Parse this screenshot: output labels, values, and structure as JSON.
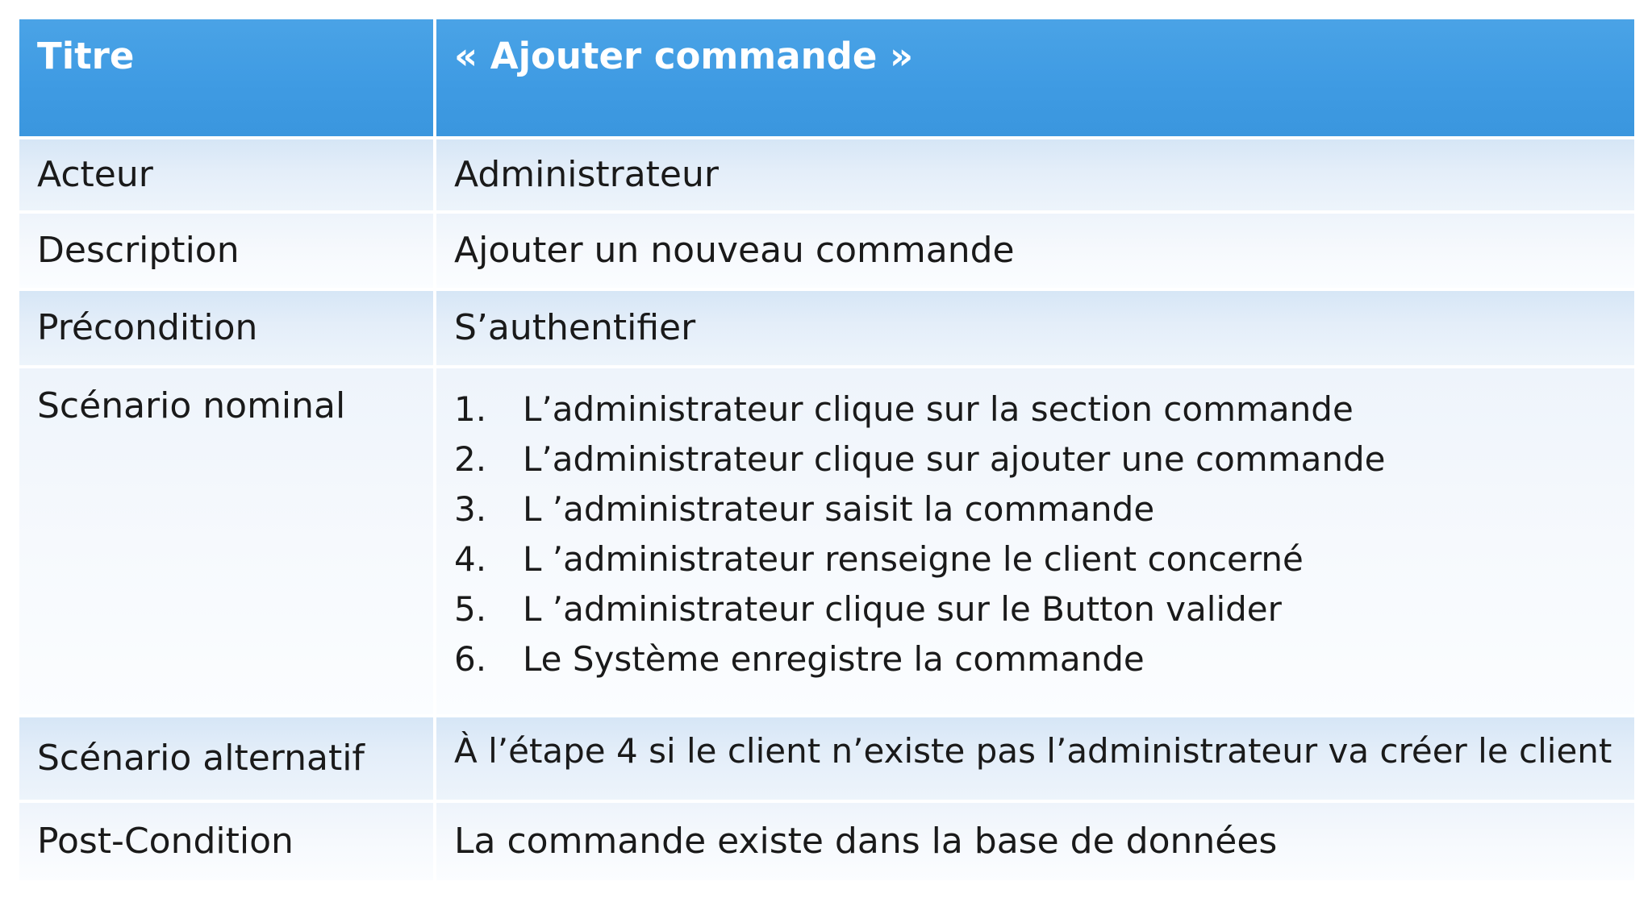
{
  "header": {
    "label": "Titre",
    "value": "« Ajouter commande  »"
  },
  "rows": [
    {
      "label": "Acteur",
      "value": "Administrateur"
    },
    {
      "label": "Description",
      "value": "Ajouter un nouveau commande"
    },
    {
      "label": "Précondition",
      "value": "S’authentifier"
    }
  ],
  "scenario": {
    "label": "Scénario nominal",
    "steps": [
      {
        "num": "1.",
        "text": "L’administrateur clique sur la section commande"
      },
      {
        "num": "2.",
        "text": "L’administrateur clique sur ajouter une commande"
      },
      {
        "num": "3.",
        "text": "L ’administrateur saisit la commande"
      },
      {
        "num": "4.",
        "text": "L ’administrateur renseigne le client concerné"
      },
      {
        "num": "5.",
        "text": "L ’administrateur clique sur le Button valider"
      },
      {
        "num": "6.",
        "text": "Le Système enregistre la commande"
      }
    ]
  },
  "alternative": {
    "label": "Scénario alternatif",
    "value": "À l’étape 4 si le client n’existe pas l’administrateur va créer le client"
  },
  "post": {
    "label": "Post-Condition",
    "value": "La commande existe dans la base de données"
  },
  "colors": {
    "header_bg": "#3f9be3",
    "band_bg": "#dde9f7",
    "light_bg": "#f4f8fd"
  }
}
